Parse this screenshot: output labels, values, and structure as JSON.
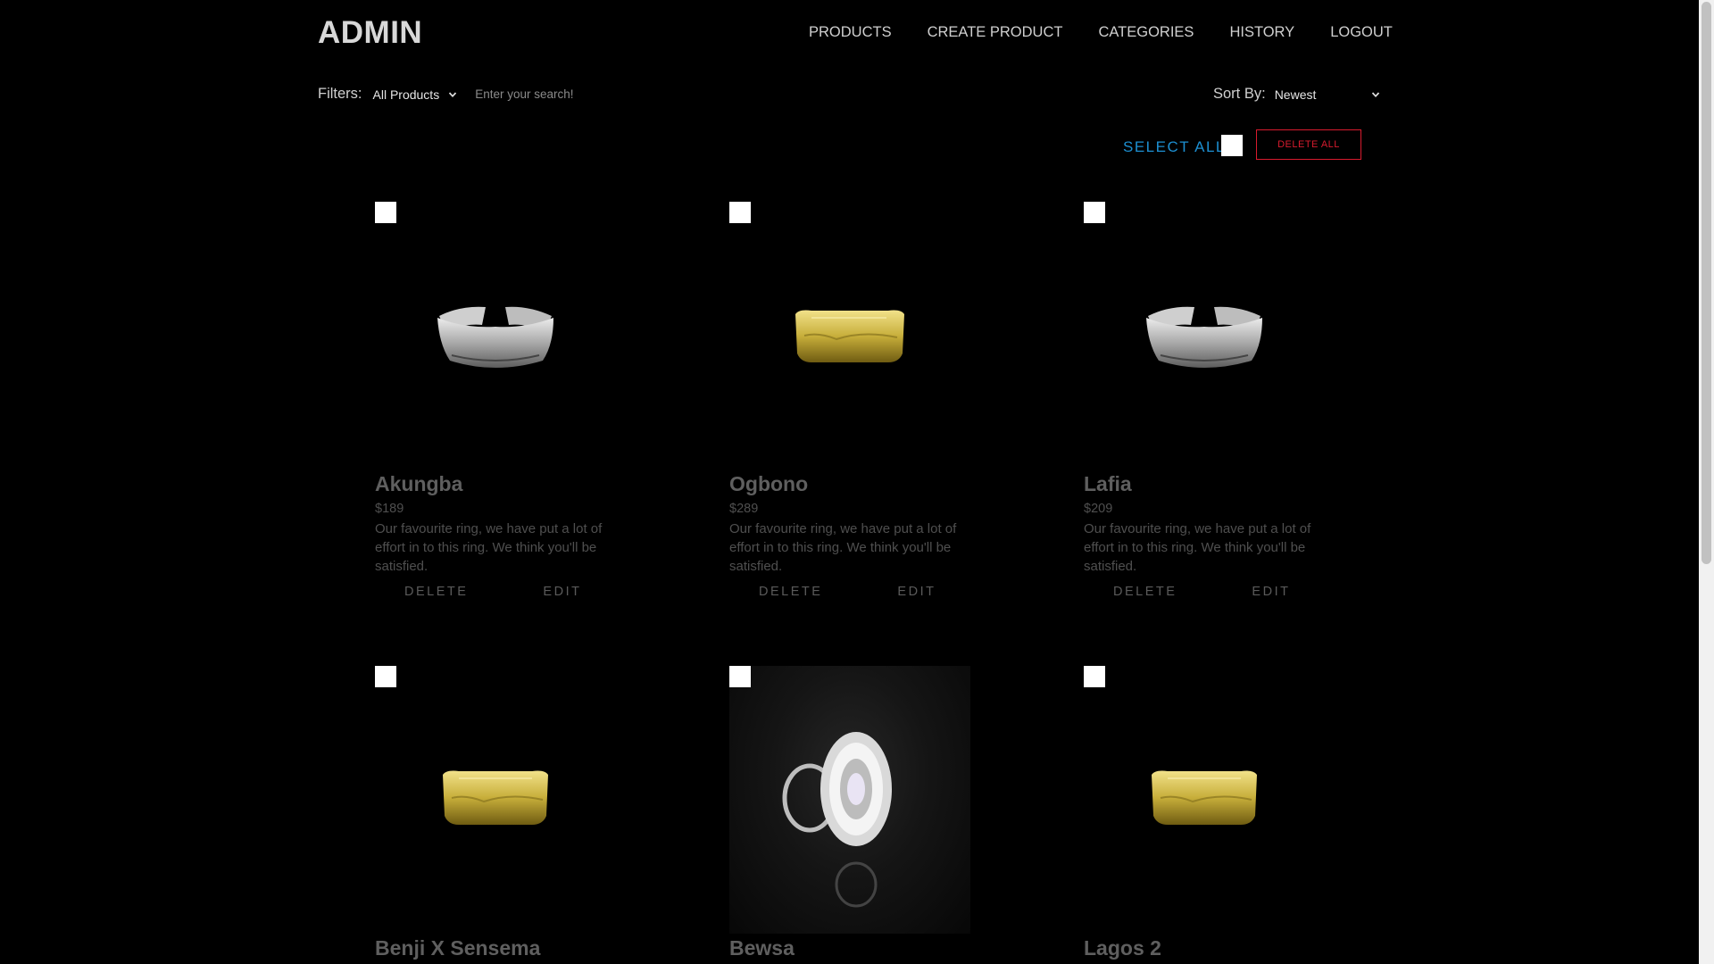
{
  "header": {
    "brand": "ADMIN",
    "nav": [
      {
        "label": "PRODUCTS"
      },
      {
        "label": "CREATE PRODUCT"
      },
      {
        "label": "CATEGORIES"
      },
      {
        "label": "HISTORY"
      },
      {
        "label": "LOGOUT"
      }
    ]
  },
  "filters": {
    "label": "Filters:",
    "category_value": "All Products",
    "search_placeholder": "Enter your search!"
  },
  "sort": {
    "label": "Sort By:",
    "value": "Newest"
  },
  "bulk": {
    "select_all_label": "SELECT ALL",
    "delete_all_label": "DELETE ALL"
  },
  "colors": {
    "accent_blue": "#1d8fd1",
    "danger_red": "#d81b2e",
    "background": "#000000"
  },
  "card_actions": {
    "delete_label": "DELETE",
    "edit_label": "EDIT"
  },
  "products": [
    {
      "name": "Akungba",
      "price": "$189",
      "description": "Our favourite ring, we have put a lot of effort in to this ring. We think you'll be satisfied.",
      "image": "silver-band-ring"
    },
    {
      "name": "Ogbono",
      "price": "$289",
      "description": "Our favourite ring, we have put a lot of effort in to this ring. We think you'll be satisfied.",
      "image": "gold-band-ring"
    },
    {
      "name": "Lafia",
      "price": "$209",
      "description": "Our favourite ring, we have put a lot of effort in to this ring. We think you'll be satisfied.",
      "image": "silver-band-ring"
    },
    {
      "name": "Benji X Sensema",
      "image": "gold-band-ring"
    },
    {
      "name": "Bewsa",
      "image": "diamond-cluster-ring"
    },
    {
      "name": "Lagos 2",
      "image": "gold-band-ring"
    }
  ]
}
